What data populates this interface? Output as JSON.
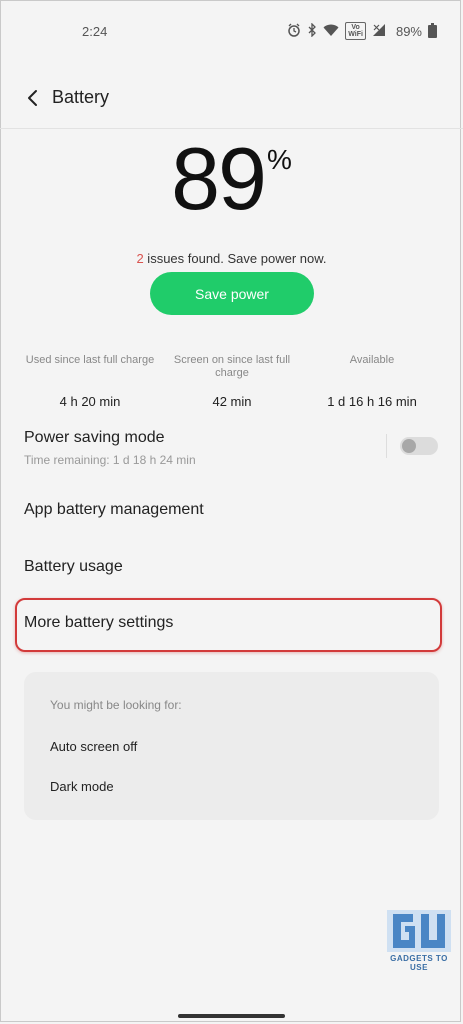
{
  "status_bar": {
    "time": "2:24",
    "vowifi_top": "Vo",
    "vowifi_bottom": "WiFi",
    "battery_percent": "89%"
  },
  "header": {
    "title": "Battery"
  },
  "battery": {
    "level_number": "89",
    "level_unit": "%",
    "issues_count": "2",
    "issues_text": " issues found. Save power now.",
    "save_button_label": "Save power"
  },
  "stats": [
    {
      "label": "Used since last full charge",
      "value": "4 h 20 min"
    },
    {
      "label": "Screen on since last full charge",
      "value": "42 min"
    },
    {
      "label": "Available",
      "value": "1 d 16 h 16 min"
    }
  ],
  "power_saving": {
    "title": "Power saving mode",
    "subtitle": "Time remaining:  1 d 18 h 24 min",
    "enabled": false
  },
  "menu": {
    "app_battery_management": "App battery management",
    "battery_usage": "Battery usage",
    "more_battery_settings": "More battery settings"
  },
  "suggestions": {
    "heading": "You might be looking for:",
    "items": [
      "Auto screen off",
      "Dark mode"
    ]
  },
  "watermark": {
    "text": "GADGETS TO USE"
  },
  "colors": {
    "accent_green": "#20cc6a",
    "issue_red": "#d9534f",
    "highlight_red": "#d23a3a"
  }
}
